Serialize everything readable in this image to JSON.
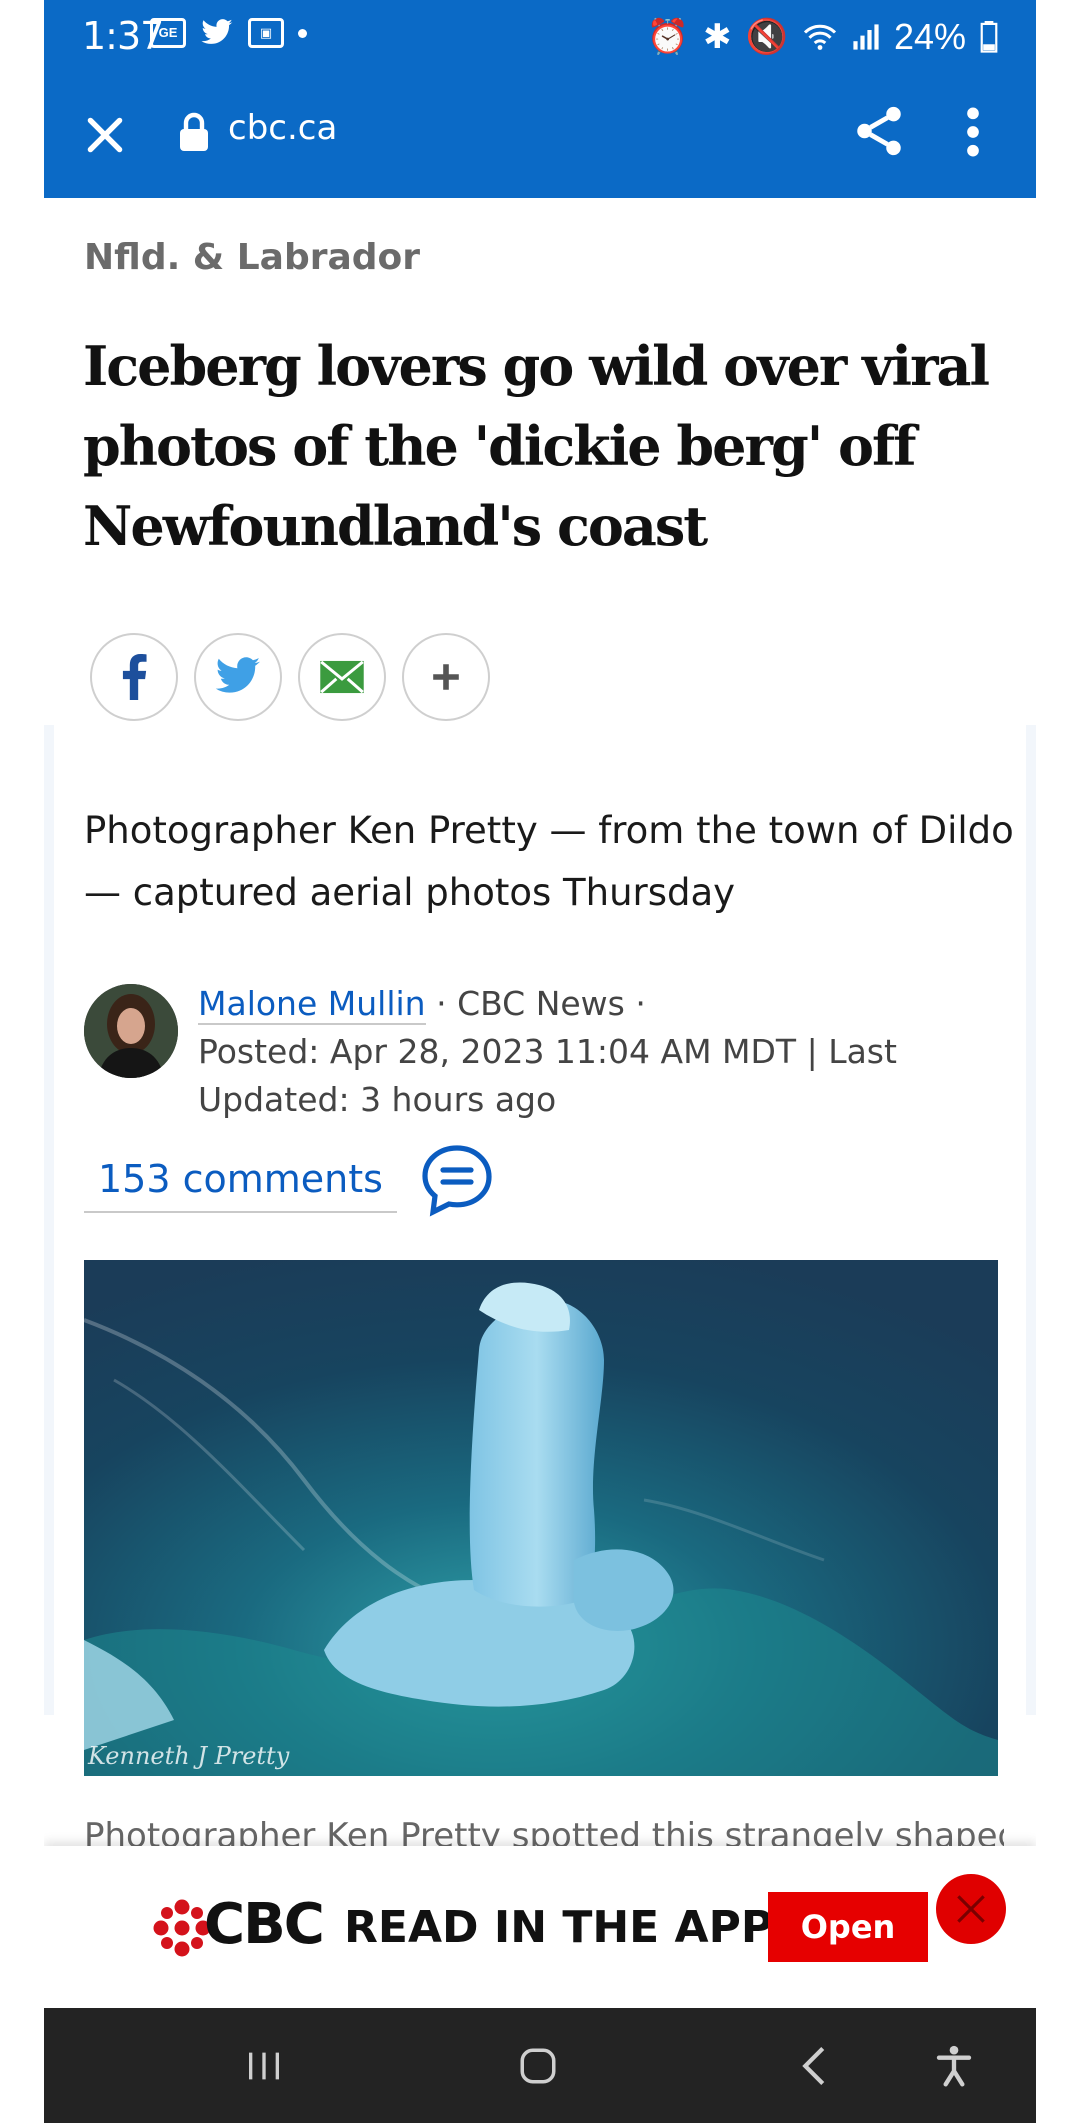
{
  "status_bar": {
    "time": "1:37",
    "battery": "24%",
    "left_icons": [
      "gmail-icon",
      "twitter-icon",
      "notification-icon",
      "dot-indicator"
    ],
    "right_icons": [
      "alarm-icon",
      "bluetooth-icon",
      "mute-icon",
      "wifi-icon",
      "signal-icon",
      "battery-icon"
    ]
  },
  "url_bar": {
    "domain": "cbc.ca"
  },
  "article": {
    "category": "Nfld. & Labrador",
    "headline": "Iceberg lovers go wild over viral photos of the 'dickie berg' off Newfoundland's coast",
    "share_buttons": [
      "facebook",
      "twitter",
      "email",
      "more"
    ],
    "deck": "Photographer Ken Pretty — from the town of Dildo — captured aerial photos Thursday",
    "author": "Malone Mullin",
    "outlet": "CBC News",
    "posted": "Posted: Apr 28, 2023 11:04 AM MDT | Last Updated: 3 hours ago",
    "comments": "153 comments",
    "photo_credit": "Kenneth J Pretty",
    "caption": "Photographer Ken Pretty spotted this strangely shaped"
  },
  "app_banner": {
    "brand": "CBC",
    "text": "READ IN THE APP",
    "open_label": "Open"
  },
  "colors": {
    "header_blue": "#0b6ac6",
    "link_blue": "#0b5cc0",
    "cbc_red": "#e60000"
  }
}
